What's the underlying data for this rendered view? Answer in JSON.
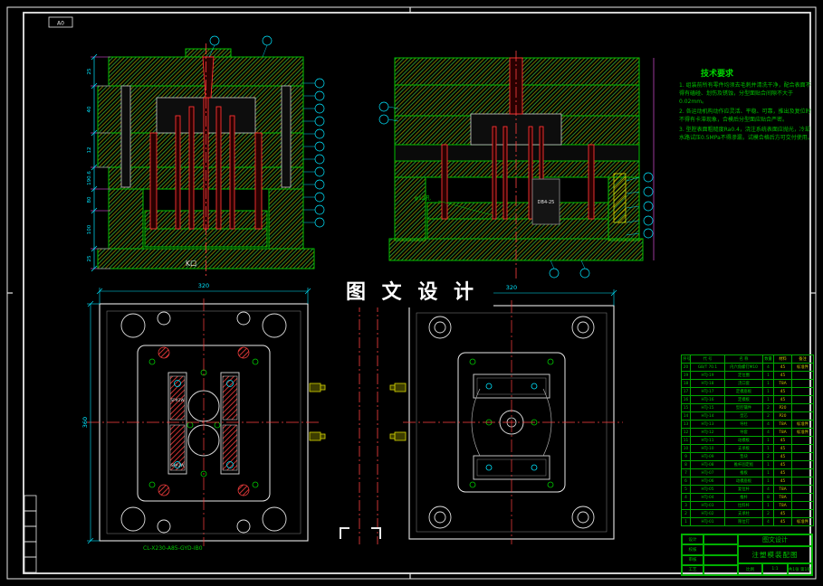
{
  "meta": {
    "corner_label": "A0",
    "watermark": "图 文 设 计",
    "drawing_code": "CL-X230-A85-GYD-IB0"
  },
  "colors": {
    "background": "#000000",
    "frame_white": "#e8e8e8",
    "line_green": "#00bf00",
    "hatch_green": "#2e8b2e",
    "hatch_yellow": "#8f8f00",
    "dim_cyan": "#00e5ff",
    "center_red": "#ff4040",
    "magenta": "#ff5cff",
    "text_green": "#00c800"
  },
  "section_front": {
    "k_label": "K口",
    "dims": [
      "25",
      "40",
      "12",
      "190.6",
      "80",
      "100",
      "25"
    ]
  },
  "section_side": {
    "db_label": "DB4-25",
    "phi_label": "φ12孔"
  },
  "plan_left": {
    "width_label": "320",
    "height_label": "360",
    "slot_label": "SP#2W",
    "code": "CL-X230-A85-GYD-IB0"
  },
  "plan_right": {
    "width_label": "320"
  },
  "tech_requirements": {
    "title": "技术要求",
    "lines": [
      "1. 组装前所有零件均须去毛刺并清洗干净，配合表面不得有磕碰、划伤及锈蚀，分型面贴合间隙不大于0.02mm。",
      "2. 各运动机构动作应灵活、平稳、可靠，推出及复位时不得有卡滞现象，合模后分型面应贴合严密。",
      "3. 型腔表面粗糙度Ra0.4，浇注系统表面应抛光，冷却水路试压0.5MPa不得渗漏，试模合格后方可交付使用。"
    ]
  },
  "parts_table": {
    "headers": [
      "序号",
      "代 号",
      "名 称",
      "数量",
      "材料",
      "备注"
    ],
    "rows": [
      [
        "20",
        "GB/T 70.1",
        "内六角螺钉M10",
        "4",
        "45",
        "标准件"
      ],
      [
        "19",
        "HTJ-19",
        "定位圈",
        "1",
        "45",
        ""
      ],
      [
        "18",
        "HTJ-18",
        "浇口套",
        "1",
        "T8A",
        ""
      ],
      [
        "17",
        "HTJ-17",
        "定模座板",
        "1",
        "45",
        ""
      ],
      [
        "16",
        "HTJ-16",
        "定模板",
        "1",
        "45",
        ""
      ],
      [
        "15",
        "HTJ-15",
        "型腔镶件",
        "2",
        "P20",
        ""
      ],
      [
        "14",
        "HTJ-14",
        "型芯",
        "2",
        "P20",
        ""
      ],
      [
        "13",
        "HTJ-13",
        "导柱",
        "4",
        "T8A",
        "标准件"
      ],
      [
        "12",
        "HTJ-12",
        "导套",
        "4",
        "T8A",
        "标准件"
      ],
      [
        "11",
        "HTJ-11",
        "动模板",
        "1",
        "45",
        ""
      ],
      [
        "10",
        "HTJ-10",
        "支承板",
        "1",
        "45",
        ""
      ],
      [
        "9",
        "HTJ-09",
        "垫块",
        "2",
        "45",
        ""
      ],
      [
        "8",
        "HTJ-08",
        "推杆固定板",
        "1",
        "45",
        ""
      ],
      [
        "7",
        "HTJ-07",
        "推板",
        "1",
        "45",
        ""
      ],
      [
        "6",
        "HTJ-06",
        "动模座板",
        "1",
        "45",
        ""
      ],
      [
        "5",
        "HTJ-05",
        "复位杆",
        "4",
        "T8A",
        ""
      ],
      [
        "4",
        "HTJ-04",
        "推杆",
        "8",
        "T8A",
        ""
      ],
      [
        "3",
        "HTJ-03",
        "拉料杆",
        "1",
        "T8A",
        ""
      ],
      [
        "2",
        "HTJ-02",
        "支承柱",
        "2",
        "45",
        ""
      ],
      [
        "1",
        "HTJ-01",
        "限位钉",
        "4",
        "45",
        "标准件"
      ]
    ]
  },
  "title_block": {
    "company": "图文设计",
    "title": "注塑模装配图",
    "designer": "设计",
    "checker": "校核",
    "approver": "审核",
    "craft": "工艺",
    "scale_label": "比例",
    "scale": "1:1",
    "sheet": "共1张 第1张"
  }
}
